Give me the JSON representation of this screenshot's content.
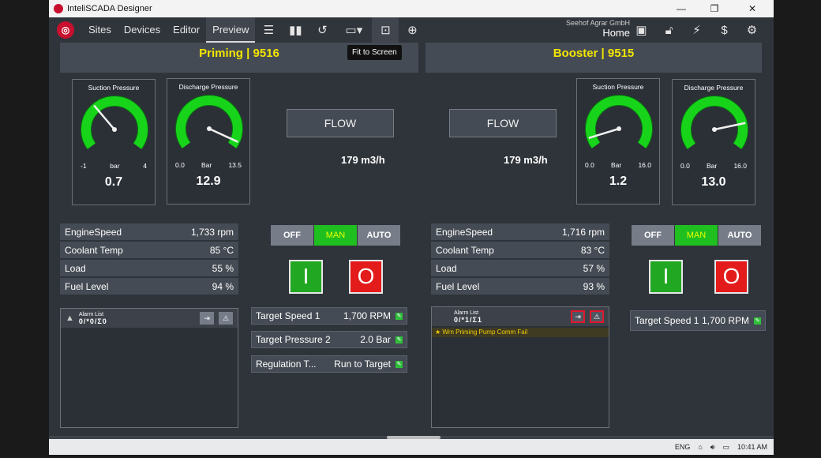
{
  "window": {
    "title": "InteliSCADA Designer",
    "minimize": "—",
    "maximize": "❐",
    "close": "✕"
  },
  "nav": {
    "sites": "Sites",
    "devices": "Devices",
    "editor": "Editor",
    "preview": "Preview"
  },
  "company": {
    "name": "Seehof Agrar GmbH",
    "page": "Home"
  },
  "tooltip": "Fit to Screen",
  "priming": {
    "title": "Priming | 9516",
    "suction": {
      "title": "Suction Pressure",
      "min": "-1",
      "unit": "bar",
      "max": "4",
      "value": "0.7",
      "fraction": 0.34
    },
    "discharge": {
      "title": "Discharge Pressure",
      "min": "0.0",
      "unit": "Bar",
      "max": "13.5",
      "value": "12.9",
      "fraction": 0.955
    },
    "flow_label": "FLOW",
    "flow_value": "179 m3/h",
    "stats": [
      {
        "label": "EngineSpeed",
        "value": "1,733 rpm"
      },
      {
        "label": "Coolant Temp",
        "value": "85 °C"
      },
      {
        "label": "Load",
        "value": "55 %"
      },
      {
        "label": "Fuel Level",
        "value": "94 %"
      }
    ],
    "modes": {
      "off": "OFF",
      "man": "MAN",
      "auto": "AUTO"
    },
    "start_label": "I",
    "stop_label": "O",
    "alarm": {
      "title": "Alarm List",
      "counts": "0/*0/Σ0"
    },
    "params": [
      {
        "label": "Target Speed 1",
        "value": "1,700 RPM"
      },
      {
        "label": "Target Pressure 2",
        "value": "2.0 Bar"
      },
      {
        "label": "Regulation T...",
        "value": "Run to Target"
      }
    ]
  },
  "booster": {
    "title": "Booster | 9515",
    "suction": {
      "title": "Suction Pressure",
      "min": "0.0",
      "unit": "Bar",
      "max": "16.0",
      "value": "1.2",
      "fraction": 0.075
    },
    "discharge": {
      "title": "Discharge Pressure",
      "min": "0.0",
      "unit": "Bar",
      "max": "16.0",
      "value": "13.0",
      "fraction": 0.81
    },
    "flow_label": "FLOW",
    "flow_value": "179 m3/h",
    "stats": [
      {
        "label": "EngineSpeed",
        "value": "1,716 rpm"
      },
      {
        "label": "Coolant Temp",
        "value": "83 °C"
      },
      {
        "label": "Load",
        "value": "57 %"
      },
      {
        "label": "Fuel Level",
        "value": "93 %"
      }
    ],
    "modes": {
      "off": "OFF",
      "man": "MAN",
      "auto": "AUTO"
    },
    "start_label": "I",
    "stop_label": "O",
    "alarm": {
      "title": "Alarm List",
      "counts": "0/*1/Σ1",
      "items": [
        "Wrn Priming Pump Comm Fail"
      ]
    },
    "params": [
      {
        "label": "Target Speed 1",
        "value": "1,700 RPM"
      }
    ]
  },
  "taskbar": {
    "lang": "ENG",
    "time": "10:41 AM"
  },
  "colors": {
    "gauge_green": "#17d41a",
    "header_yellow": "#f3e600",
    "mode_active": "#1fbf1f",
    "start_green": "#22a722",
    "stop_red": "#e31b1b"
  }
}
